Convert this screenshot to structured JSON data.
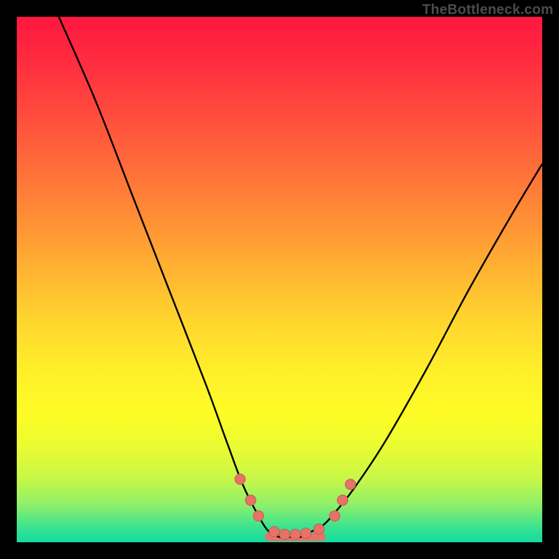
{
  "watermark": "TheBottleneck.com",
  "colors": {
    "frame": "#000000",
    "curve_stroke": "#000000",
    "marker_fill": "#e57368",
    "marker_stroke": "#c95a50",
    "gradient_stops": [
      "#ff173f",
      "#ff2b3f",
      "#ff4a3e",
      "#ff6b3a",
      "#ff8d36",
      "#ffb232",
      "#ffd62e",
      "#fff02a",
      "#fdfd26",
      "#e9fb32",
      "#c6f748",
      "#8cef6b",
      "#3ee38f",
      "#12dca0"
    ]
  },
  "chart_data": {
    "type": "line",
    "title": "",
    "xlabel": "",
    "ylabel": "",
    "xlim": [
      0,
      100
    ],
    "ylim": [
      0,
      100
    ],
    "x": [
      8,
      15,
      22,
      29,
      36,
      40,
      43,
      46,
      48,
      50,
      52,
      54,
      56,
      58,
      60,
      64,
      70,
      78,
      86,
      94,
      100
    ],
    "values": [
      100,
      84,
      66,
      48,
      30,
      19,
      11,
      5,
      2,
      1,
      1,
      1,
      2,
      3,
      5,
      10,
      19,
      33,
      48,
      62,
      72
    ],
    "floor_segment": {
      "x_start": 48,
      "x_end": 58,
      "y": 1
    },
    "markers": [
      {
        "x": 42.5,
        "y": 12
      },
      {
        "x": 44.5,
        "y": 8
      },
      {
        "x": 46.0,
        "y": 5
      },
      {
        "x": 49.0,
        "y": 2
      },
      {
        "x": 51.0,
        "y": 1.5
      },
      {
        "x": 53.0,
        "y": 1.5
      },
      {
        "x": 55.0,
        "y": 1.7
      },
      {
        "x": 57.5,
        "y": 2.5
      },
      {
        "x": 60.5,
        "y": 5
      },
      {
        "x": 62.0,
        "y": 8
      },
      {
        "x": 63.5,
        "y": 11
      }
    ]
  }
}
